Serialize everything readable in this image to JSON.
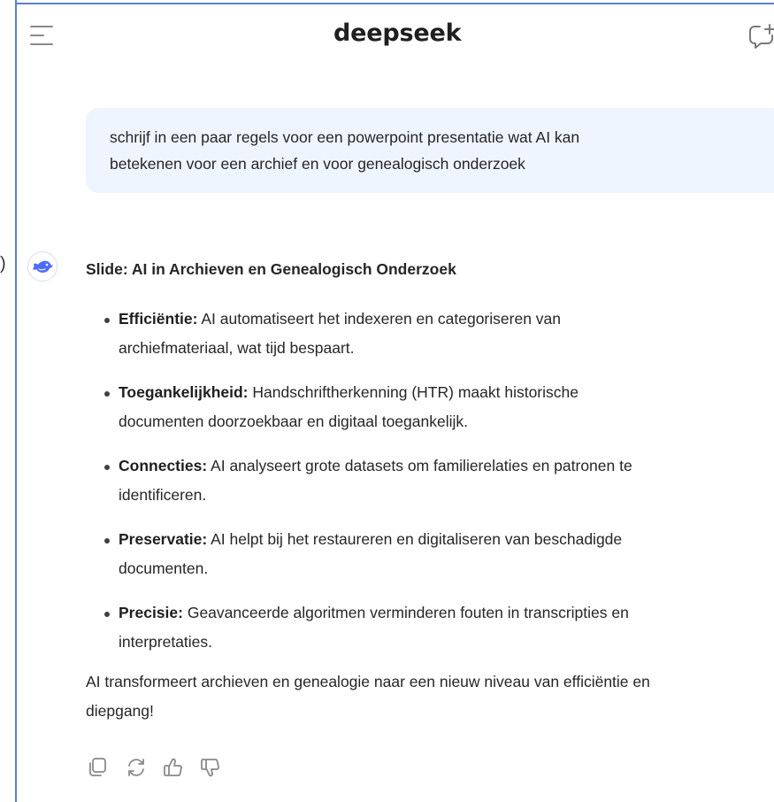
{
  "app": {
    "logo_text": "deepseek",
    "menu_icon": "hamburger-menu-icon",
    "new_chat_icon": "new-chat-icon",
    "side_glyph": ")"
  },
  "colors": {
    "frame_border": "#5b80c4",
    "user_bubble_bg": "#eff5ff",
    "avatar_whale": "#4d6bfe",
    "text": "#262626"
  },
  "user_message": {
    "line1": "schrijf in een paar regels voor een powerpoint presentatie wat AI kan",
    "line2": "betekenen voor een archief en voor genealogisch onderzoek"
  },
  "assistant": {
    "avatar_icon": "deepseek-whale-icon",
    "title": "Slide: AI in Archieven en Genealogisch Onderzoek",
    "bullets": [
      {
        "term": "Efficiëntie:",
        "line1": " AI automatiseert het indexeren en categoriseren van",
        "line2": "archiefmateriaal, wat tijd bespaart."
      },
      {
        "term": "Toegankelijkheid:",
        "line1": " Handschriftherkenning (HTR) maakt historische",
        "line2": "documenten doorzoekbaar en digitaal toegankelijk."
      },
      {
        "term": "Connecties:",
        "line1": " AI analyseert grote datasets om familierelaties en patronen te",
        "line2": "identificeren."
      },
      {
        "term": "Preservatie:",
        "line1": " AI helpt bij het restaureren en digitaliseren van beschadigde",
        "line2": "documenten."
      },
      {
        "term": "Precisie:",
        "line1": " Geavanceerde algoritmen verminderen fouten in transcripties en",
        "line2": "interpretaties."
      }
    ],
    "closing_line1": "AI transformeert archieven en genealogie naar een nieuw niveau van efficiëntie en",
    "closing_line2": "diepgang!"
  },
  "actions": {
    "copy_icon": "copy-icon",
    "regenerate_icon": "regenerate-icon",
    "like_icon": "thumbs-up-icon",
    "dislike_icon": "thumbs-down-icon"
  }
}
